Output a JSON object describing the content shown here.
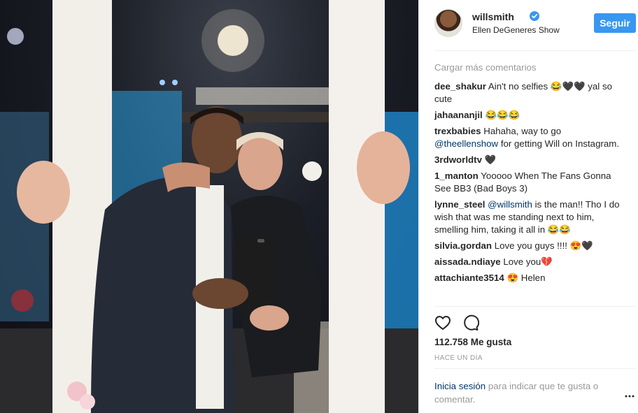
{
  "post": {
    "username": "willsmith",
    "location": "Ellen DeGeneres Show",
    "follow_label": "Seguir",
    "load_more": "Cargar más comentarios",
    "comments": [
      {
        "user": "dee_shakur",
        "text": "Ain't no selfies 😂🖤🖤 yal so cute"
      },
      {
        "user": "jahaananjil",
        "text": "😂😂😂"
      },
      {
        "user": "trexbabies",
        "text": "Hahaha, way to go",
        "mention": "@theellenshow",
        "text_after": "for getting Will on Instagram."
      },
      {
        "user": "3rdworldtv",
        "text": "🖤"
      },
      {
        "user": "1_manton",
        "text": "Yooooo When The Fans Gonna See BB3 (Bad Boys 3)"
      },
      {
        "user": "lynne_steel",
        "text": "",
        "mention": "@willsmith",
        "text_after": "is the man!! Tho I do wish that was me standing next to him, smelling him, taking it all in 😂😂"
      },
      {
        "user": "silvia.gordan",
        "text": "Love you guys !!!! 😍🖤"
      },
      {
        "user": "aissada.ndiaye",
        "text": "Love you💔"
      },
      {
        "user": "attachiante3514",
        "text": "😍 Helen"
      }
    ],
    "likes": "112.758 Me gusta",
    "time": "HACE UN DÍA",
    "login_link": "Inicia sesión",
    "login_text": "para indicar que te gusta o comentar.",
    "icons": {
      "like": "heart-icon",
      "comment": "comment-icon",
      "more": "more-options-icon",
      "verified": "verified-badge-icon"
    },
    "colors": {
      "accent": "#3897f0",
      "link": "#003569",
      "muted": "#999999"
    }
  }
}
